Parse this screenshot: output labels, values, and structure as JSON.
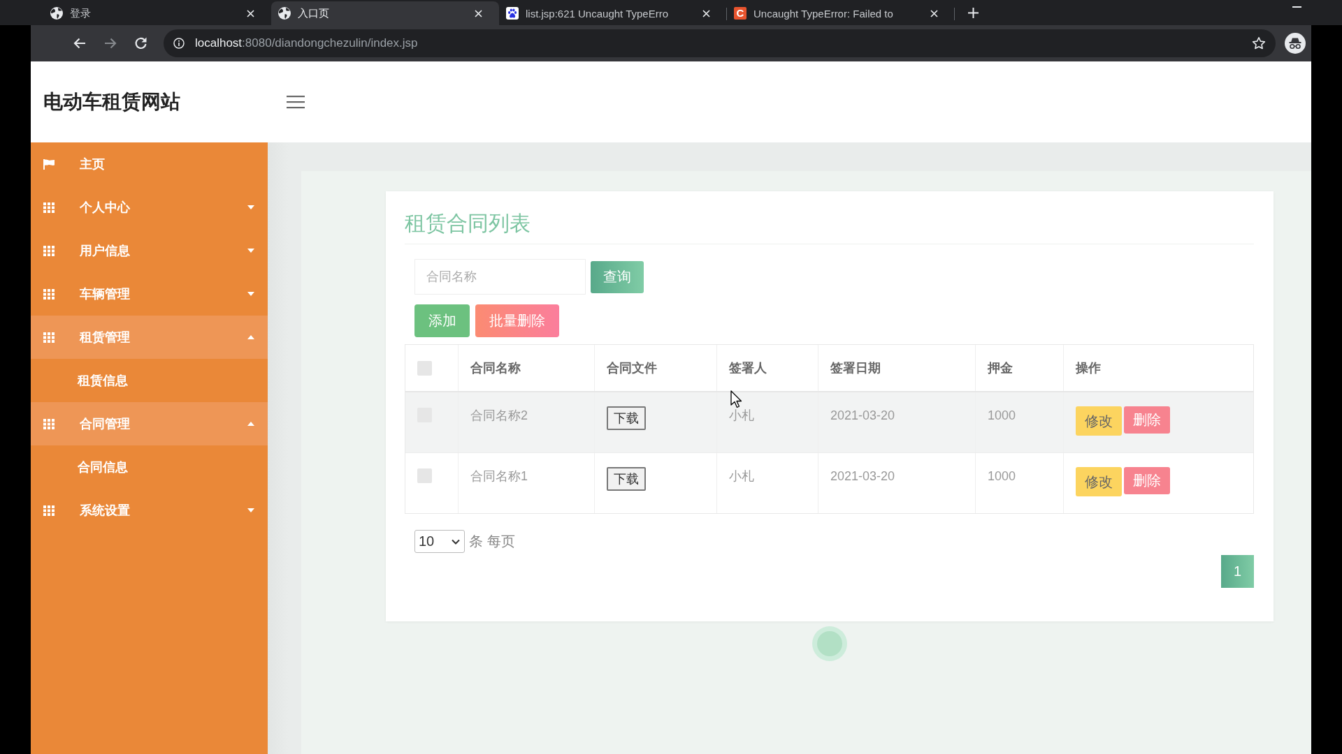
{
  "browser": {
    "tabs": [
      {
        "title": "登录",
        "selected": false
      },
      {
        "title": "入口页",
        "selected": true
      },
      {
        "title": "list.jsp:621 Uncaught TypeErro",
        "selected": false
      },
      {
        "title": "Uncaught TypeError: Failed to",
        "favicon_letter": "C",
        "selected": false
      }
    ],
    "address_bar": {
      "host": "localhost",
      "path": ":8080/diandongchezulin/index.jsp"
    }
  },
  "header": {
    "site_title": "电动车租赁网站"
  },
  "sidebar": {
    "items": [
      {
        "label": "主页",
        "kind": "link"
      },
      {
        "label": "个人中心",
        "kind": "menu",
        "expanded": false
      },
      {
        "label": "用户信息",
        "kind": "menu",
        "expanded": false
      },
      {
        "label": "车辆管理",
        "kind": "menu",
        "expanded": false
      },
      {
        "label": "租赁管理",
        "kind": "menu",
        "expanded": true,
        "children": [
          {
            "label": "租赁信息"
          }
        ]
      },
      {
        "label": "合同管理",
        "kind": "menu",
        "expanded": true,
        "children": [
          {
            "label": "合同信息"
          }
        ]
      },
      {
        "label": "系统设置",
        "kind": "menu",
        "expanded": false
      }
    ]
  },
  "content": {
    "title": "租赁合同列表",
    "search": {
      "placeholder": "合同名称",
      "button": "查询"
    },
    "actions": [
      {
        "label": "添加",
        "kind": "add"
      },
      {
        "label": "批量删除",
        "kind": "delete"
      }
    ],
    "table": {
      "select_all": {
        "checked": false
      },
      "columns": [
        "合同名称",
        "合同文件",
        "签署人",
        "签署日期",
        "押金",
        "操作"
      ],
      "rows": [
        {
          "checked": false,
          "hovered": true,
          "name": "合同名称2",
          "file_button": "下载",
          "signer": "小札",
          "date": "2021-03-20",
          "deposit": "1000",
          "actions": [
            {
              "label": "修改",
              "kind": "edit"
            },
            {
              "label": "删除",
              "kind": "delete"
            }
          ]
        },
        {
          "checked": false,
          "hovered": false,
          "name": "合同名称1",
          "file_button": "下载",
          "signer": "小札",
          "date": "2021-03-20",
          "deposit": "1000",
          "actions": [
            {
              "label": "修改",
              "kind": "edit"
            },
            {
              "label": "删除",
              "kind": "delete"
            }
          ]
        }
      ]
    },
    "pagination": {
      "page_size": "10",
      "page_size_label": "条 每页",
      "pages": [
        {
          "label": "1",
          "selected": true
        }
      ]
    }
  }
}
